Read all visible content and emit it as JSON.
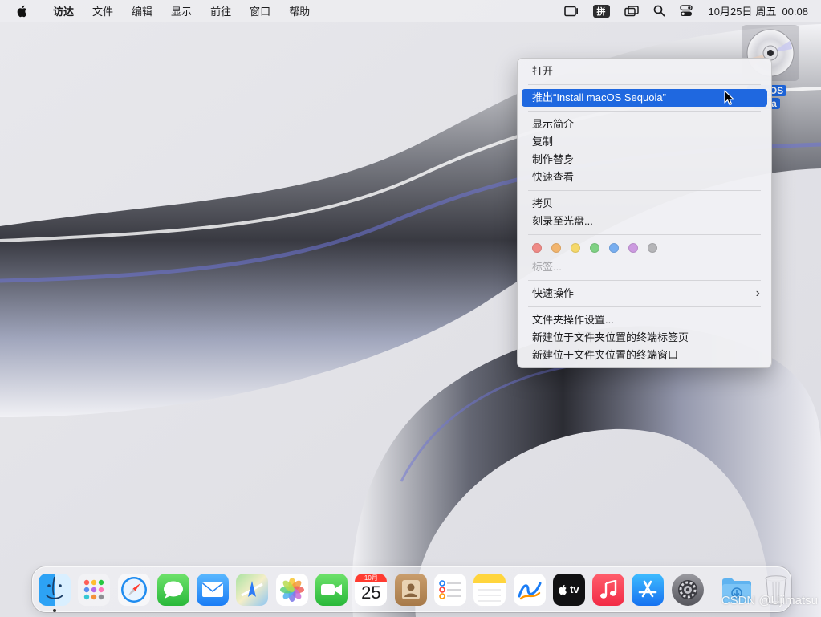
{
  "menubar": {
    "items": [
      {
        "label": "访达"
      },
      {
        "label": "文件"
      },
      {
        "label": "编辑"
      },
      {
        "label": "显示"
      },
      {
        "label": "前往"
      },
      {
        "label": "窗口"
      },
      {
        "label": "帮助"
      }
    ],
    "status": {
      "input_method": "拼",
      "date": "10月25日",
      "weekday": "周五",
      "time": "00:08"
    }
  },
  "desktop": {
    "disk": {
      "label_line1": "macOS",
      "label_line2": "uoia",
      "icon": "optical-disc-icon"
    }
  },
  "context_menu": {
    "groups": [
      [
        {
          "label": "打开"
        }
      ],
      [
        {
          "label": "推出“Install macOS Sequoia”",
          "highlighted": true
        }
      ],
      [
        {
          "label": "显示简介"
        },
        {
          "label": "复制"
        },
        {
          "label": "制作替身"
        },
        {
          "label": "快速查看"
        }
      ],
      [
        {
          "label": "拷贝"
        },
        {
          "label": "刻录至光盘..."
        }
      ]
    ],
    "tag_colors": [
      "#ef8a86",
      "#f2b56e",
      "#f5d86a",
      "#7fd184",
      "#78aef0",
      "#cc9ae0",
      "#b5b5b8"
    ],
    "tags_label": "标签...",
    "quick_actions": {
      "label": "快速操作",
      "has_submenu": true
    },
    "folder_actions": [
      {
        "label": "文件夹操作设置..."
      },
      {
        "label": "新建位于文件夹位置的终端标签页"
      },
      {
        "label": "新建位于文件夹位置的终端窗口"
      }
    ]
  },
  "dock": {
    "apps": [
      {
        "name": "finder",
        "running": true
      },
      {
        "name": "launchpad"
      },
      {
        "name": "safari"
      },
      {
        "name": "messages"
      },
      {
        "name": "mail"
      },
      {
        "name": "maps"
      },
      {
        "name": "photos"
      },
      {
        "name": "facetime"
      },
      {
        "name": "calendar",
        "month": "10月",
        "day": "25"
      },
      {
        "name": "contacts"
      },
      {
        "name": "reminders"
      },
      {
        "name": "notes"
      },
      {
        "name": "freeform"
      },
      {
        "name": "tv",
        "label": "tv"
      },
      {
        "name": "music"
      },
      {
        "name": "app-store"
      },
      {
        "name": "system-settings"
      }
    ],
    "right": [
      {
        "name": "downloads"
      },
      {
        "name": "trash"
      }
    ]
  },
  "watermark": "CSDN @Ujimatsu"
}
